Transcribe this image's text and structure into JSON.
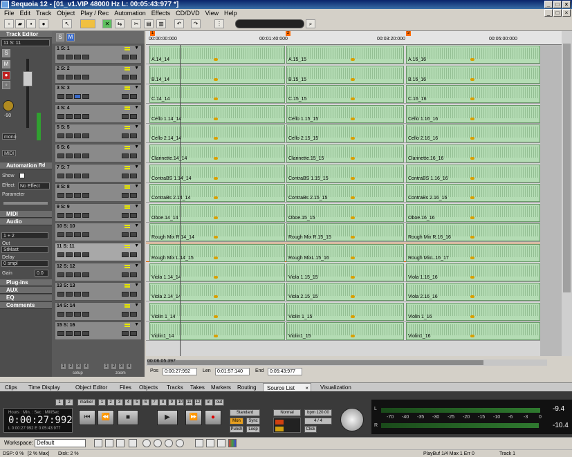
{
  "window": {
    "title": "Sequoia 12 - [01_v1.VIP   48000 Hz L: 00:05:43:977 *]"
  },
  "menu": [
    "File",
    "Edit",
    "Track",
    "Object",
    "Play / Rec",
    "Automation",
    "Effects",
    "CD/DVD",
    "View",
    "Help"
  ],
  "left_panel": {
    "track_editor_label": "Track Editor",
    "current_track": "11  S: 11",
    "gain_value": "-90",
    "btn_s": "S",
    "btn_m": "M",
    "mono_label": "mono",
    "midi_label": "MIDI",
    "automation_label": "Automation",
    "rd_label": "Rd",
    "show_label": "Show",
    "effect_label": "Effect",
    "effect_value": "No Effect",
    "parameter_label": "Parameter",
    "midi_section": "MIDI",
    "audio_section": "Audio",
    "in_value": "1 + 2",
    "out_label": "Out",
    "out_value": "StMast",
    "delay_label": "Delay",
    "delay_value": "0 smpl",
    "gain_label": "Gain",
    "gain_box": "0.0",
    "plugins_section": "Plug-ins",
    "aux_section": "AUX",
    "eq_section": "EQ",
    "comments_section": "Comments"
  },
  "trackhead": {
    "setup_label": "setup",
    "zoom_label": "zoom",
    "nums": [
      "1",
      "2",
      "3",
      "4"
    ],
    "tracks": [
      {
        "num": "1",
        "name": "S: 1"
      },
      {
        "num": "2",
        "name": "S: 2"
      },
      {
        "num": "3",
        "name": "S: 3"
      },
      {
        "num": "4",
        "name": "S: 4"
      },
      {
        "num": "5",
        "name": "S: 5"
      },
      {
        "num": "6",
        "name": "S: 6"
      },
      {
        "num": "7",
        "name": "S: 7"
      },
      {
        "num": "8",
        "name": "S: 8"
      },
      {
        "num": "9",
        "name": "S: 9"
      },
      {
        "num": "10",
        "name": "S: 10"
      },
      {
        "num": "11",
        "name": "S: 11"
      },
      {
        "num": "12",
        "name": "S: 12"
      },
      {
        "num": "13",
        "name": "S: 13"
      },
      {
        "num": "14",
        "name": "S: 14"
      },
      {
        "num": "15",
        "name": "S: 16"
      }
    ]
  },
  "ruler": {
    "start": "00:00:00:000",
    "t1": "00:01:40:000",
    "t2": "00:03:20:000",
    "t3": "00:05:00:000",
    "markers": [
      "1",
      "2",
      "3"
    ],
    "end_time": "00:06:05:397"
  },
  "lanes": [
    [
      "A.14_14",
      "A.15_15",
      "A.16_16"
    ],
    [
      "B.14_14",
      "B.15_15",
      "B.16_16"
    ],
    [
      "C.14_14",
      "C.15_15",
      "C.16_16"
    ],
    [
      "Cello 1.14_14",
      "Cello 1.15_15",
      "Cello 1.16_16"
    ],
    [
      "Cello 2.14_14",
      "Cello 2.15_15",
      "Cello 2.16_16"
    ],
    [
      "Clarinette.14_14",
      "Clarinette.15_15",
      "Clarinette.16_16"
    ],
    [
      "ContraBS 1.14_14",
      "ContraBS 1.15_15",
      "ContraBS 1.16_16"
    ],
    [
      "ContraBs 2.14_14",
      "ContraBs 2.15_15",
      "ContraBs 2.16_16"
    ],
    [
      "Oboe.14_14",
      "Oboe.15_15",
      "Oboe.16_16"
    ],
    [
      "Rough Mix R.14_14",
      "Rough Mix R.15_15",
      "Rough Mix R.16_16"
    ],
    [
      "Rough Mix L.14_15",
      "Rough MixL.15_16",
      "Rough MixL.16_17"
    ],
    [
      "Viola 1.14_14",
      "Viola 1.15_15",
      "Viola 1.16_16"
    ],
    [
      "Viola 2.14_14",
      "Viola 2.15_15",
      "Viola 2.16_16"
    ],
    [
      "Violin 1_14",
      "Violin 1_15",
      "Violin 1_16"
    ],
    [
      "Violin1_14",
      "Violin1_15",
      "Violin1_16"
    ]
  ],
  "position_bar": {
    "pos_label": "Pos",
    "pos_value": "0:00:27:992",
    "len_label": "Len",
    "len_value": "0:01:57:140",
    "end_label": "End",
    "end_value": "0:05:43:977"
  },
  "tabs": [
    "Clips",
    "Time Display",
    "Object Editor",
    "Files",
    "Objects",
    "Tracks",
    "Takes",
    "Markers",
    "Routing",
    "Source List",
    "Visualization"
  ],
  "transport": {
    "marker_label": "marker",
    "marker_nums": [
      "1",
      "2",
      "3",
      "4",
      "5",
      "6",
      "7",
      "8",
      "9",
      "10",
      "11",
      "12"
    ],
    "in_label": "in",
    "out_label": "out",
    "time_header": "Hours : Min. : Sec : MilliSec",
    "time_value": "0:00:27:992",
    "l_label": "L 0:00:27:992",
    "e_label": "E 0:05:43:977",
    "standard": "Standard",
    "mon": "Mon",
    "sync": "Sync",
    "punch": "Punch",
    "loop": "Loop",
    "normal": "Normal",
    "bpm": "bpm 120.00",
    "sig": "4 / 4",
    "click": "Click"
  },
  "meters": {
    "scale": [
      "-70",
      "-40",
      "-35",
      "-30",
      "-25",
      "-20",
      "-15",
      "-10",
      "-6",
      "-3",
      "0"
    ],
    "l": "L",
    "r": "R",
    "peak_l": "-9.4",
    "peak_r": "-10.4"
  },
  "workspace": {
    "label": "Workspace:",
    "value": "Default"
  },
  "status": {
    "dsp": "DSP: 0 %",
    "max": "[2 % Max]",
    "disk": "Disk: 2 %",
    "playbuf": "PlayBuf 1/4  Max 1  Err 0",
    "track": "Track 1"
  },
  "colors": {
    "clip": "#b4dcb4",
    "accent": "#3a6ac8",
    "marker": "#ff6a00"
  }
}
